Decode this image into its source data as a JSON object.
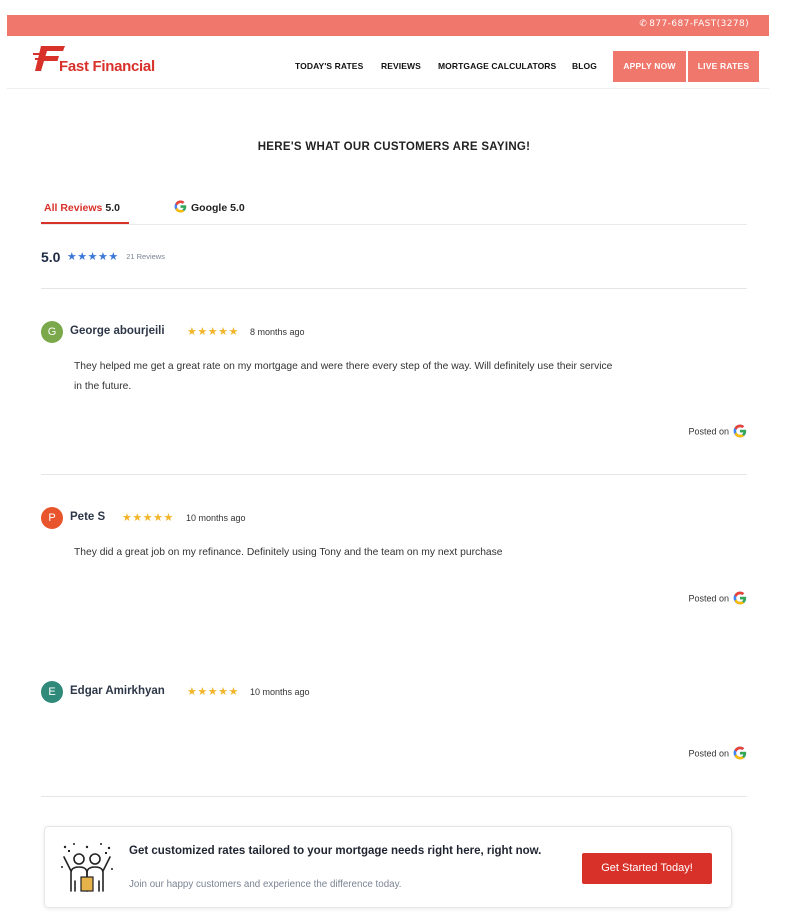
{
  "topbar": {
    "phone": "877-687-FAST(3278)"
  },
  "header": {
    "brand": "Fast Financial",
    "nav": [
      "TODAY'S RATES",
      "REVIEWS",
      "MORTGAGE CALCULATORS",
      "BLOG"
    ],
    "apply_label": "APPLY NOW",
    "live_rates_label": "LIVE RATES"
  },
  "colors": {
    "accent": "#d8312a",
    "topbar": "#ef776c",
    "star_gold": "#f2b52a",
    "star_blue": "#3a78d8"
  },
  "reviews_section": {
    "title": "HERE'S WHAT OUR CUSTOMERS ARE SAYING!",
    "tabs": [
      {
        "label": "All Reviews",
        "score": "5.0"
      },
      {
        "label": "Google",
        "score": "5.0",
        "icon": "google-g-icon"
      }
    ],
    "summary": {
      "score": "5.0",
      "stars": "★★★★★",
      "count": "21 Reviews"
    },
    "reviews": [
      {
        "initial": "G",
        "avatar_color": "#7aa84a",
        "name": "George abourjeili",
        "stars": "★★★★★",
        "date": "8 months ago",
        "text": "They helped me get a great rate on my mortgage and were there every step of the way. Will definitely use their service in the future.",
        "posted_label": "Posted on"
      },
      {
        "initial": "P",
        "avatar_color": "#e8542b",
        "name": "Pete S",
        "stars": "★★★★★",
        "date": "10 months ago",
        "text": "They did a great job on my refinance. Definitely using Tony and the team on my next purchase",
        "posted_label": "Posted on"
      },
      {
        "initial": "E",
        "avatar_color": "#2f8a7a",
        "name": "Edgar Amirkhyan",
        "stars": "★★★★★",
        "date": "10 months ago",
        "text": "",
        "posted_label": "Posted on"
      }
    ]
  },
  "cta": {
    "title": "Get customized rates tailored to your mortgage needs right here, right now.",
    "subtitle": "Join our happy customers and experience the difference today.",
    "button_label": "Get Started Today!"
  }
}
